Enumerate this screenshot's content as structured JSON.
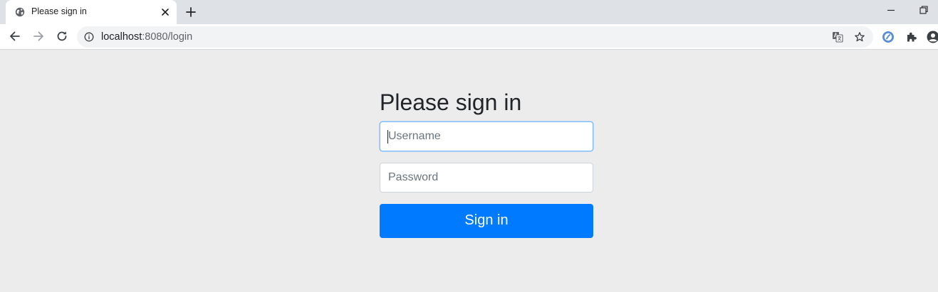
{
  "browser": {
    "tab": {
      "title": "Please sign in"
    },
    "address": {
      "host": "localhost",
      "rest": ":8080/login"
    }
  },
  "icons": {
    "favicon": "globe-icon",
    "tab_close": "close-icon",
    "new_tab": "plus-icon",
    "minimize": "minimize-icon",
    "restore": "restore-icon",
    "back": "arrow-left-icon",
    "forward": "arrow-right-icon",
    "reload": "reload-icon",
    "site_info": "info-icon",
    "translate": "translate-icon",
    "bookmark": "star-icon",
    "extension": "extension-icon",
    "extensions_menu": "puzzle-icon",
    "profile": "profile-icon"
  },
  "form": {
    "heading": "Please sign in",
    "username_placeholder": "Username",
    "password_placeholder": "Password",
    "submit_label": "Sign in"
  },
  "colors": {
    "page_background": "#ececec",
    "primary_button": "#007bff",
    "focus_border": "#80bdff",
    "heading_text": "#212529"
  }
}
